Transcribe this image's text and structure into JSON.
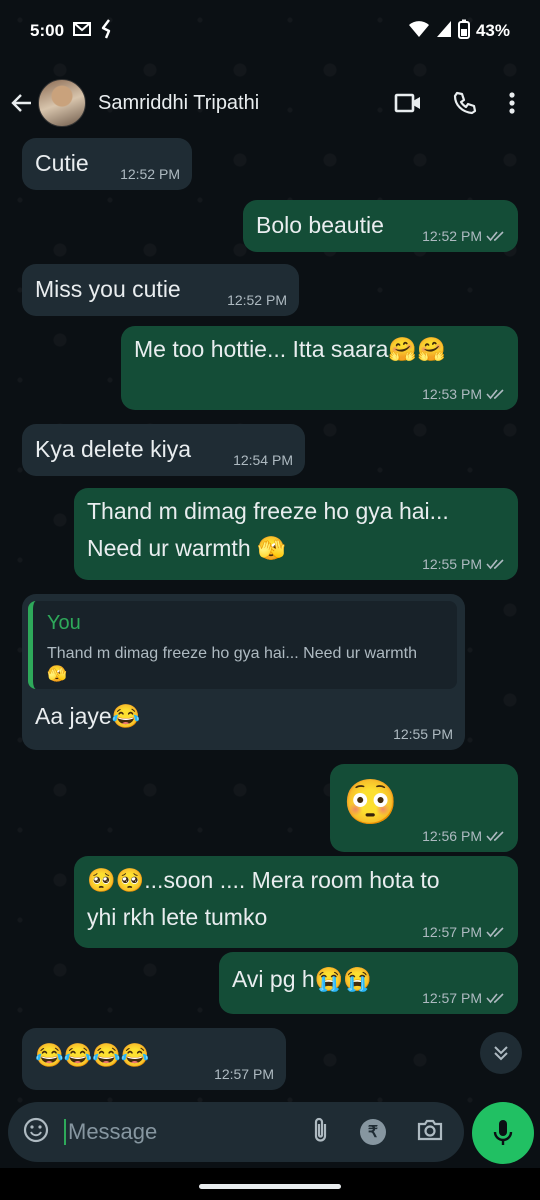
{
  "status_bar": {
    "time": "5:00",
    "battery": "43%"
  },
  "header": {
    "contact_name": "Samriddhi Tripathi"
  },
  "messages": [
    {
      "text": "Cutie",
      "time": "12:52 PM"
    },
    {
      "text": "Bolo beautie",
      "time": "12:52 PM"
    },
    {
      "text": "Miss you cutie",
      "time": "12:52 PM"
    },
    {
      "text": "Me too hottie... Itta saara🤗🤗",
      "time": "12:53 PM"
    },
    {
      "text": "Kya delete kiya",
      "time": "12:54 PM"
    },
    {
      "line1": "Thand m dimag freeze ho gya hai...",
      "line2": "Need ur warmth 🫣",
      "time": "12:55 PM"
    },
    {
      "quote_author": "You",
      "quote_text": "Thand m dimag freeze ho gya hai... Need ur warmth 🫣",
      "text": "Aa jaye😂",
      "time": "12:55 PM"
    },
    {
      "text": "😳",
      "time": "12:56 PM"
    },
    {
      "line1": "🥺🥺...soon .... Mera room hota to",
      "line2": "yhi rkh lete tumko",
      "time": "12:57 PM"
    },
    {
      "text": "Avi pg h😭😭",
      "time": "12:57 PM"
    },
    {
      "text": "😂😂😂😂",
      "time": "12:57 PM"
    }
  ],
  "composer": {
    "placeholder": "Message",
    "payment_symbol": "₹"
  },
  "colors": {
    "incoming_bubble": "#1f2c34",
    "outgoing_bubble": "#144d37",
    "accent": "#21c063",
    "background": "#0b1014"
  },
  "icons": [
    "gmail-icon",
    "kite-icon",
    "wifi-icon",
    "signal-icon",
    "battery-icon",
    "back-arrow-icon",
    "video-call-icon",
    "phone-icon",
    "more-vert-icon",
    "double-check-icon",
    "scroll-down-icon",
    "emoji-icon",
    "attach-icon",
    "camera-icon",
    "mic-icon"
  ]
}
